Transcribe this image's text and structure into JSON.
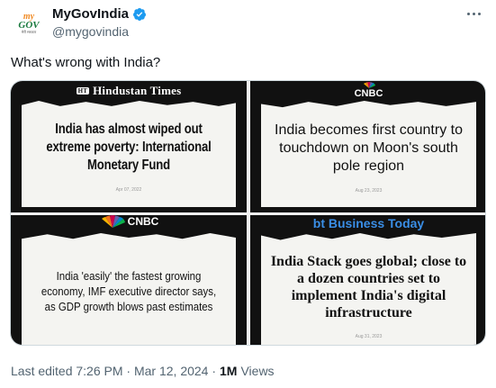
{
  "account": {
    "display_name": "MyGovIndia",
    "handle": "@mygovindia",
    "avatar_text": [
      "my",
      "GOV",
      "मेरी सरकार"
    ],
    "verified": true,
    "verified_color": "#1d9bf0"
  },
  "tweet": {
    "text": "What's wrong with India?"
  },
  "media": {
    "panels": [
      {
        "brand": "Hindustan Times",
        "brand_mark": "HT",
        "headline": "India has almost wiped out extreme poverty: International Monetary Fund",
        "date": "Apr 07, 2022"
      },
      {
        "brand": "CNBC",
        "headline": "India becomes first country to touchdown on Moon's south pole region",
        "date": "Aug 23, 2023"
      },
      {
        "brand": "CNBC",
        "headline": "India 'easily' the fastest growing economy, IMF executive director says, as GDP growth blows past estimates",
        "date": ""
      },
      {
        "brand": "Business Today",
        "brand_mark": "bt",
        "headline": "India Stack goes global; close to a dozen countries set to implement India's digital infrastructure",
        "date": "Aug 31, 2023"
      }
    ]
  },
  "footer": {
    "edited": "Last edited 7:26 PM · Mar 12, 2024 ·",
    "views_count": "1M",
    "views_label": "Views"
  },
  "icons": {
    "more": "more-options-icon",
    "verified": "verified-badge-icon"
  }
}
